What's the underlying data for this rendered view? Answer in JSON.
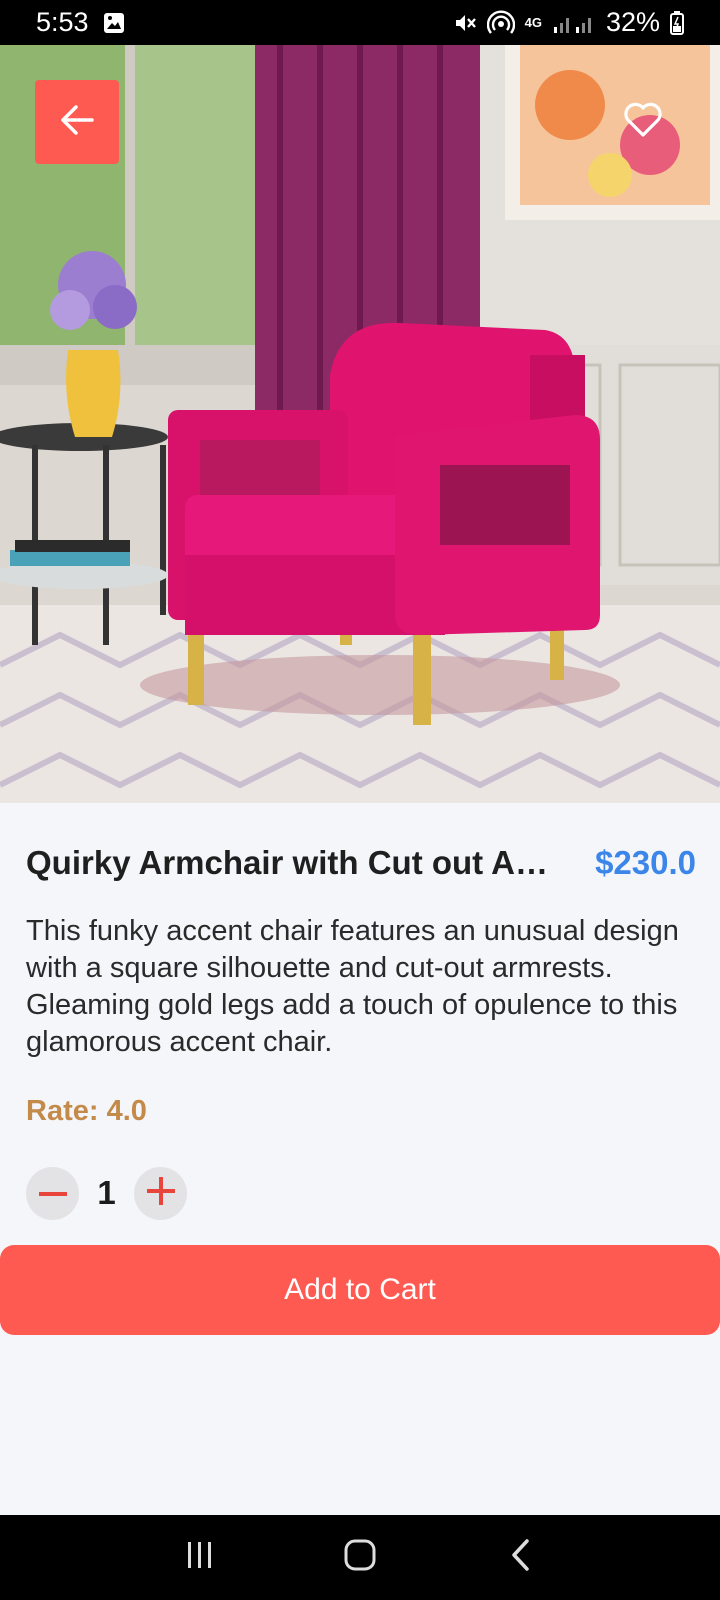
{
  "status_bar": {
    "time": "5:53",
    "battery": "32%",
    "network": "4G",
    "icons": [
      "image-icon",
      "mute-icon",
      "hotspot-icon",
      "signal-icon",
      "battery-icon"
    ]
  },
  "hero": {
    "image_alt": "Pink armchair in living room",
    "back_icon": "arrow-left-icon",
    "favorite_icon": "heart-outline-icon"
  },
  "product": {
    "title": "Quirky Armchair with Cut out Ar…",
    "price": "$230.0",
    "description": "This funky accent chair features an unusual design with a square silhouette and cut-out armrests. Gleaming gold legs add a touch of opulence to this glamorous accent chair.",
    "rate": "Rate: 4.0",
    "quantity": "1"
  },
  "actions": {
    "add_to_cart": "Add to Cart"
  },
  "colors": {
    "accent": "#ff5a52",
    "price": "#3b86e8",
    "rate": "#c48a4a",
    "background": "#f5f6fa"
  },
  "nav_bar": {
    "icons": [
      "recent-apps-icon",
      "home-icon",
      "back-icon"
    ]
  }
}
